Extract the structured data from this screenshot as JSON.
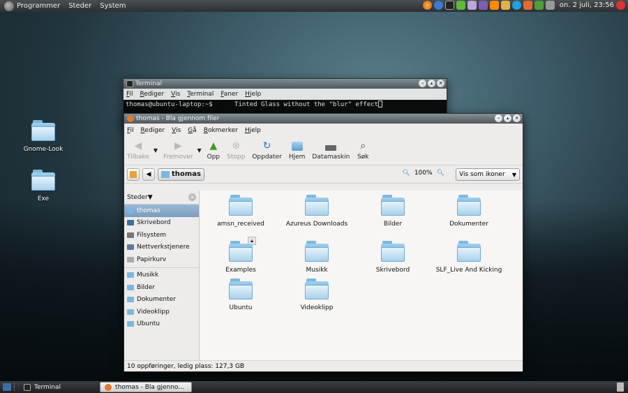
{
  "top_panel": {
    "menus": [
      "Programmer",
      "Steder",
      "System"
    ],
    "clock": "on.  2 juli, 23:56",
    "tray_icons": [
      "firefox-icon",
      "help-icon",
      "terminal-icon",
      "gem-icon",
      "notes-icon",
      "pidgin-icon",
      "vlc-icon",
      "users-icon",
      "skype-icon",
      "update-icon",
      "network-icon",
      "volume-icon",
      "power-icon"
    ]
  },
  "desktop": {
    "icons": [
      {
        "label": "Gnome-Look"
      },
      {
        "label": "Exe"
      }
    ]
  },
  "terminal": {
    "title": "Terminal",
    "menu": [
      "Fil",
      "Rediger",
      "Vis",
      "Terminal",
      "Faner",
      "Hjelp"
    ],
    "prompt": "thomas@ubuntu-laptop:~$",
    "command": "Tinted Glass without the \"blur\" effect"
  },
  "nautilus": {
    "title": "thomas - Bla gjennom filer",
    "menu": [
      "Fil",
      "Rediger",
      "Vis",
      "Gå",
      "Bokmerker",
      "Hjelp"
    ],
    "toolbar": {
      "back": "Tilbake",
      "forward": "Fremover",
      "up": "Opp",
      "stop": "Stopp",
      "reload": "Oppdater",
      "home": "Hjem",
      "computer": "Datamaskin",
      "search": "Søk"
    },
    "location": {
      "current": "thomas",
      "zoom": "100%",
      "view": "Vis som ikoner"
    },
    "sidebar": {
      "header": "Steder",
      "places": [
        "thomas",
        "Skrivebord",
        "Filsystem",
        "Nettverkstjenere",
        "Papirkurv"
      ],
      "bookmarks": [
        "Musikk",
        "Bilder",
        "Dokumenter",
        "Videoklipp",
        "Ubuntu"
      ]
    },
    "files": [
      "amsn_received",
      "Azureus Downloads",
      "Bilder",
      "Dokumenter",
      "Examples",
      "Musikk",
      "Skrivebord",
      "SLF_Live And Kicking",
      "Ubuntu",
      "Videoklipp"
    ],
    "status": "10 oppføringer, ledig plass: 127,3 GB"
  },
  "bottom_panel": {
    "tasks": [
      "Terminal",
      "thomas - Bla gjenno..."
    ]
  }
}
